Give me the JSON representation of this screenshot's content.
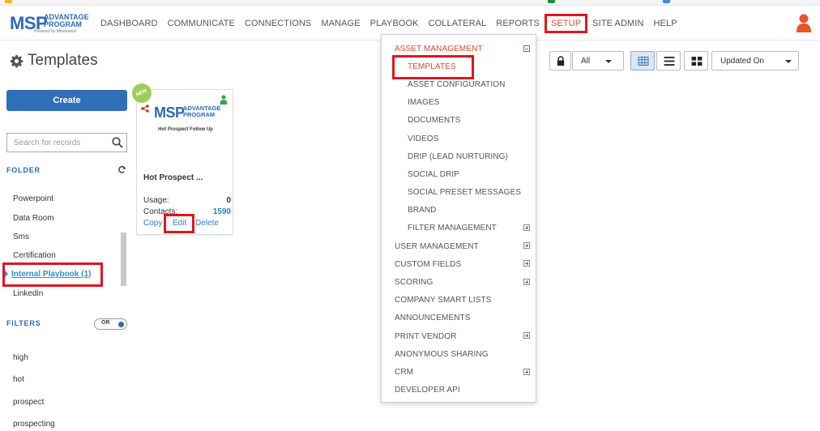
{
  "colors": {
    "accent": "#2f6fb7",
    "highlight_red": "#e0161e",
    "active_nav": "#e04a2c",
    "new_badge": "#9ccf5a",
    "user_icon": "#e8552a"
  },
  "brand": {
    "msp": "MSP",
    "advantage": "ADVANTAGE",
    "program": "PROGRAM",
    "powered_by": "Powered by Mindmatrix"
  },
  "nav": {
    "items": [
      "DASHBOARD",
      "COMMUNICATE",
      "CONNECTIONS",
      "MANAGE",
      "PLAYBOOK",
      "COLLATERAL",
      "REPORTS",
      "SETUP",
      "SITE ADMIN",
      "HELP"
    ],
    "active": "SETUP"
  },
  "page": {
    "title": "Templates"
  },
  "sidebar": {
    "create_label": "Create",
    "search_placeholder": "Search for records",
    "folder_heading": "FOLDER",
    "folders": [
      "Powerpoint",
      "Data Room",
      "Sms",
      "Certification",
      "Internal Playbook  (1)",
      "Linkedin"
    ],
    "active_folder": "Internal Playbook  (1)",
    "filters_heading": "FILTERS",
    "filter_toggle_label": "OR",
    "filters": [
      "high",
      "hot",
      "prospect",
      "prospecting"
    ]
  },
  "card": {
    "badge": "NEW",
    "thumb_caption": "Hot Prospect Follow Up",
    "title": "Hot Prospect ...",
    "usage_label": "Usage:",
    "usage_value": "0",
    "contacts_label": "Contacts:",
    "contacts_value": "1590",
    "actions": [
      "Copy",
      "Edit",
      "Delete"
    ]
  },
  "toolbar": {
    "filter_value": "All",
    "sort_value": "Updated On",
    "views": [
      "grid-view",
      "list-view",
      "tile-view"
    ],
    "active_view": "grid-view"
  },
  "setup_menu": {
    "section": "ASSET MANAGEMENT",
    "sub_items": [
      "TEMPLATES",
      "ASSET CONFIGURATION",
      "IMAGES",
      "DOCUMENTS",
      "VIDEOS",
      "DRIP (LEAD NURTURING)",
      "SOCIAL DRIP",
      "SOCIAL PRESET MESSAGES",
      "BRAND",
      "FILTER MANAGEMENT"
    ],
    "selected": "TEMPLATES",
    "top_items": [
      "USER MANAGEMENT",
      "CUSTOM FIELDS",
      "SCORING",
      "COMPANY SMART LISTS",
      "ANNOUNCEMENTS",
      "PRINT VENDOR",
      "ANONYMOUS SHARING",
      "CRM",
      "DEVELOPER API"
    ]
  }
}
